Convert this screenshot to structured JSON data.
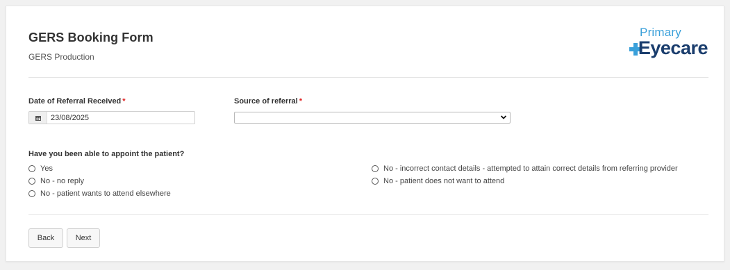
{
  "header": {
    "title": "GERS Booking Form",
    "subtitle": "GERS Production",
    "logo": {
      "line1": "Primary",
      "line2": "Eyecare",
      "line2_display": "Eyecare"
    }
  },
  "form": {
    "date_label": "Date of Referral Received",
    "date_required": "*",
    "date_value": "23/08/2025",
    "source_label": "Source of referral",
    "source_required": "*",
    "source_value": "",
    "appoint_question": "Have you been able to appoint the patient?",
    "options_left": [
      "Yes",
      "No - no reply",
      "No - patient wants to attend elsewhere"
    ],
    "options_right": [
      "No - incorrect contact details - attempted to attain correct details from referring provider",
      "No - patient does not want to attend"
    ]
  },
  "buttons": {
    "back": "Back",
    "next": "Next"
  },
  "colors": {
    "logo_primary": "#3aa0da",
    "logo_eyecare": "#1a3d6d",
    "required": "#e02020"
  }
}
